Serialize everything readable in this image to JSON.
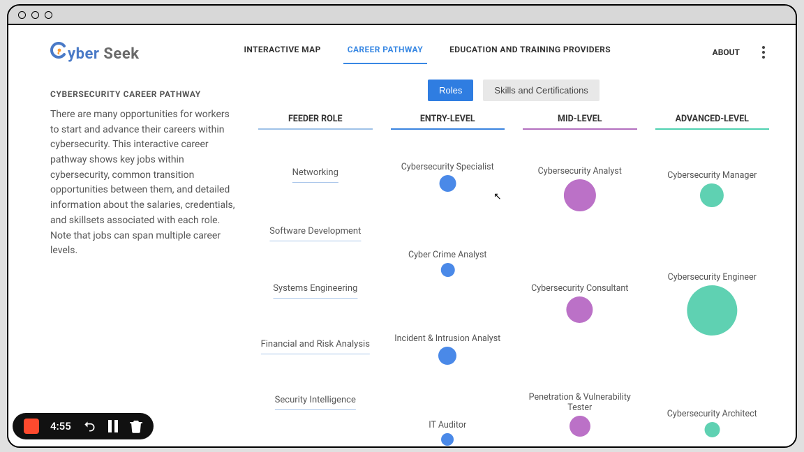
{
  "brand": {
    "part1": "yber",
    "part2": "Seek"
  },
  "nav": {
    "links": [
      "INTERACTIVE MAP",
      "CAREER PATHWAY",
      "EDUCATION AND TRAINING PROVIDERS"
    ],
    "active_index": 1,
    "about": "ABOUT"
  },
  "sidebar": {
    "title": "CYBERSECURITY CAREER PATHWAY",
    "body": "There are many opportunities for workers to start and advance their careers within cybersecurity. This interactive career pathway shows key jobs within cybersecurity, common transition opportunities between them, and detailed information about the salaries, credentials, and skillsets associated with each role. Note that jobs can span multiple career levels."
  },
  "toggle": {
    "roles": "Roles",
    "skills": "Skills and Certifications"
  },
  "columns": {
    "feeder": "FEEDER ROLE",
    "entry": "ENTRY-LEVEL",
    "mid": "MID-LEVEL",
    "adv": "ADVANCED-LEVEL"
  },
  "feeder_roles": [
    "Networking",
    "Software Development",
    "Systems Engineering",
    "Financial and Risk Analysis",
    "Security Intelligence"
  ],
  "entry_roles": [
    {
      "label": "Cybersecurity Specialist",
      "size": 24
    },
    {
      "label": "Cyber Crime Analyst",
      "size": 20
    },
    {
      "label": "Incident & Intrusion Analyst",
      "size": 26
    },
    {
      "label": "IT Auditor",
      "size": 18
    }
  ],
  "mid_roles": [
    {
      "label": "Cybersecurity Analyst",
      "size": 46
    },
    {
      "label": "Cybersecurity Consultant",
      "size": 38
    },
    {
      "label": "Penetration & Vulnerability Tester",
      "size": 30
    }
  ],
  "adv_roles": [
    {
      "label": "Cybersecurity Manager",
      "size": 34
    },
    {
      "label": "Cybersecurity Engineer",
      "size": 72
    },
    {
      "label": "Cybersecurity Architect",
      "size": 22
    }
  ],
  "recorder": {
    "time": "4:55"
  },
  "colors": {
    "blue": "#4a89e8",
    "purple": "#bb71c7",
    "teal": "#5fd1b2",
    "accent": "#3988e3"
  },
  "chart_data": {
    "type": "bubble",
    "title": "Cybersecurity Career Pathway",
    "columns": [
      "FEEDER ROLE",
      "ENTRY-LEVEL",
      "MID-LEVEL",
      "ADVANCED-LEVEL"
    ],
    "feeder": [
      "Networking",
      "Software Development",
      "Systems Engineering",
      "Financial and Risk Analysis",
      "Security Intelligence"
    ],
    "series": [
      {
        "name": "ENTRY-LEVEL",
        "color": "#4a89e8",
        "points": [
          {
            "label": "Cybersecurity Specialist",
            "size": 24
          },
          {
            "label": "Cyber Crime Analyst",
            "size": 20
          },
          {
            "label": "Incident & Intrusion Analyst",
            "size": 26
          },
          {
            "label": "IT Auditor",
            "size": 18
          }
        ]
      },
      {
        "name": "MID-LEVEL",
        "color": "#bb71c7",
        "points": [
          {
            "label": "Cybersecurity Analyst",
            "size": 46
          },
          {
            "label": "Cybersecurity Consultant",
            "size": 38
          },
          {
            "label": "Penetration & Vulnerability Tester",
            "size": 30
          }
        ]
      },
      {
        "name": "ADVANCED-LEVEL",
        "color": "#5fd1b2",
        "points": [
          {
            "label": "Cybersecurity Manager",
            "size": 34
          },
          {
            "label": "Cybersecurity Engineer",
            "size": 72
          },
          {
            "label": "Cybersecurity Architect",
            "size": 22
          }
        ]
      }
    ]
  }
}
